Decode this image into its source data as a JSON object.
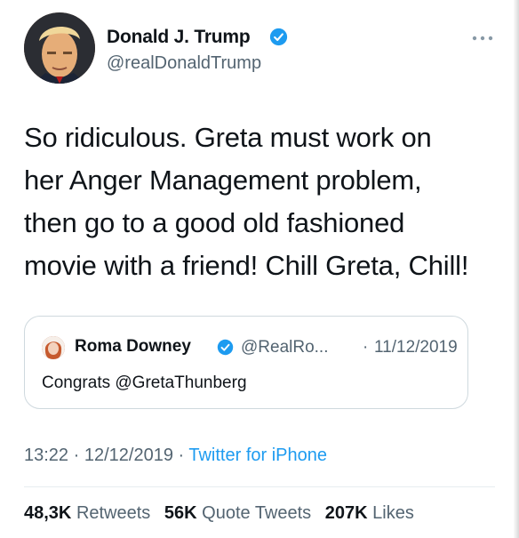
{
  "author": {
    "name": "Donald J. Trump",
    "handle": "@realDonaldTrump",
    "verified": true
  },
  "tweet": {
    "lines": [
      "So ridiculous. Greta must work on",
      "her Anger Management problem,",
      "then go to a good old fashioned",
      "movie with a friend! Chill Greta, Chill!"
    ]
  },
  "quote": {
    "name": "Roma Downey",
    "handle": "@RealRo...",
    "separator": "·",
    "date": "11/12/2019",
    "text": "Congrats @GretaThunberg",
    "verified": true
  },
  "meta": {
    "time": "13:22",
    "sep1": " · ",
    "date": "12/12/2019",
    "sep2": " · ",
    "source": "Twitter for iPhone"
  },
  "stats": {
    "retweets_count": "48,3K",
    "retweets_label": "Retweets",
    "quotes_count": "56K",
    "quotes_label": "Quote Tweets",
    "likes_count": "207K",
    "likes_label": "Likes"
  },
  "colors": {
    "text": "#0f1419",
    "secondary": "#536471",
    "link": "#1d9bf0",
    "verified": "#1d9bf0",
    "border": "#cfd9de"
  }
}
